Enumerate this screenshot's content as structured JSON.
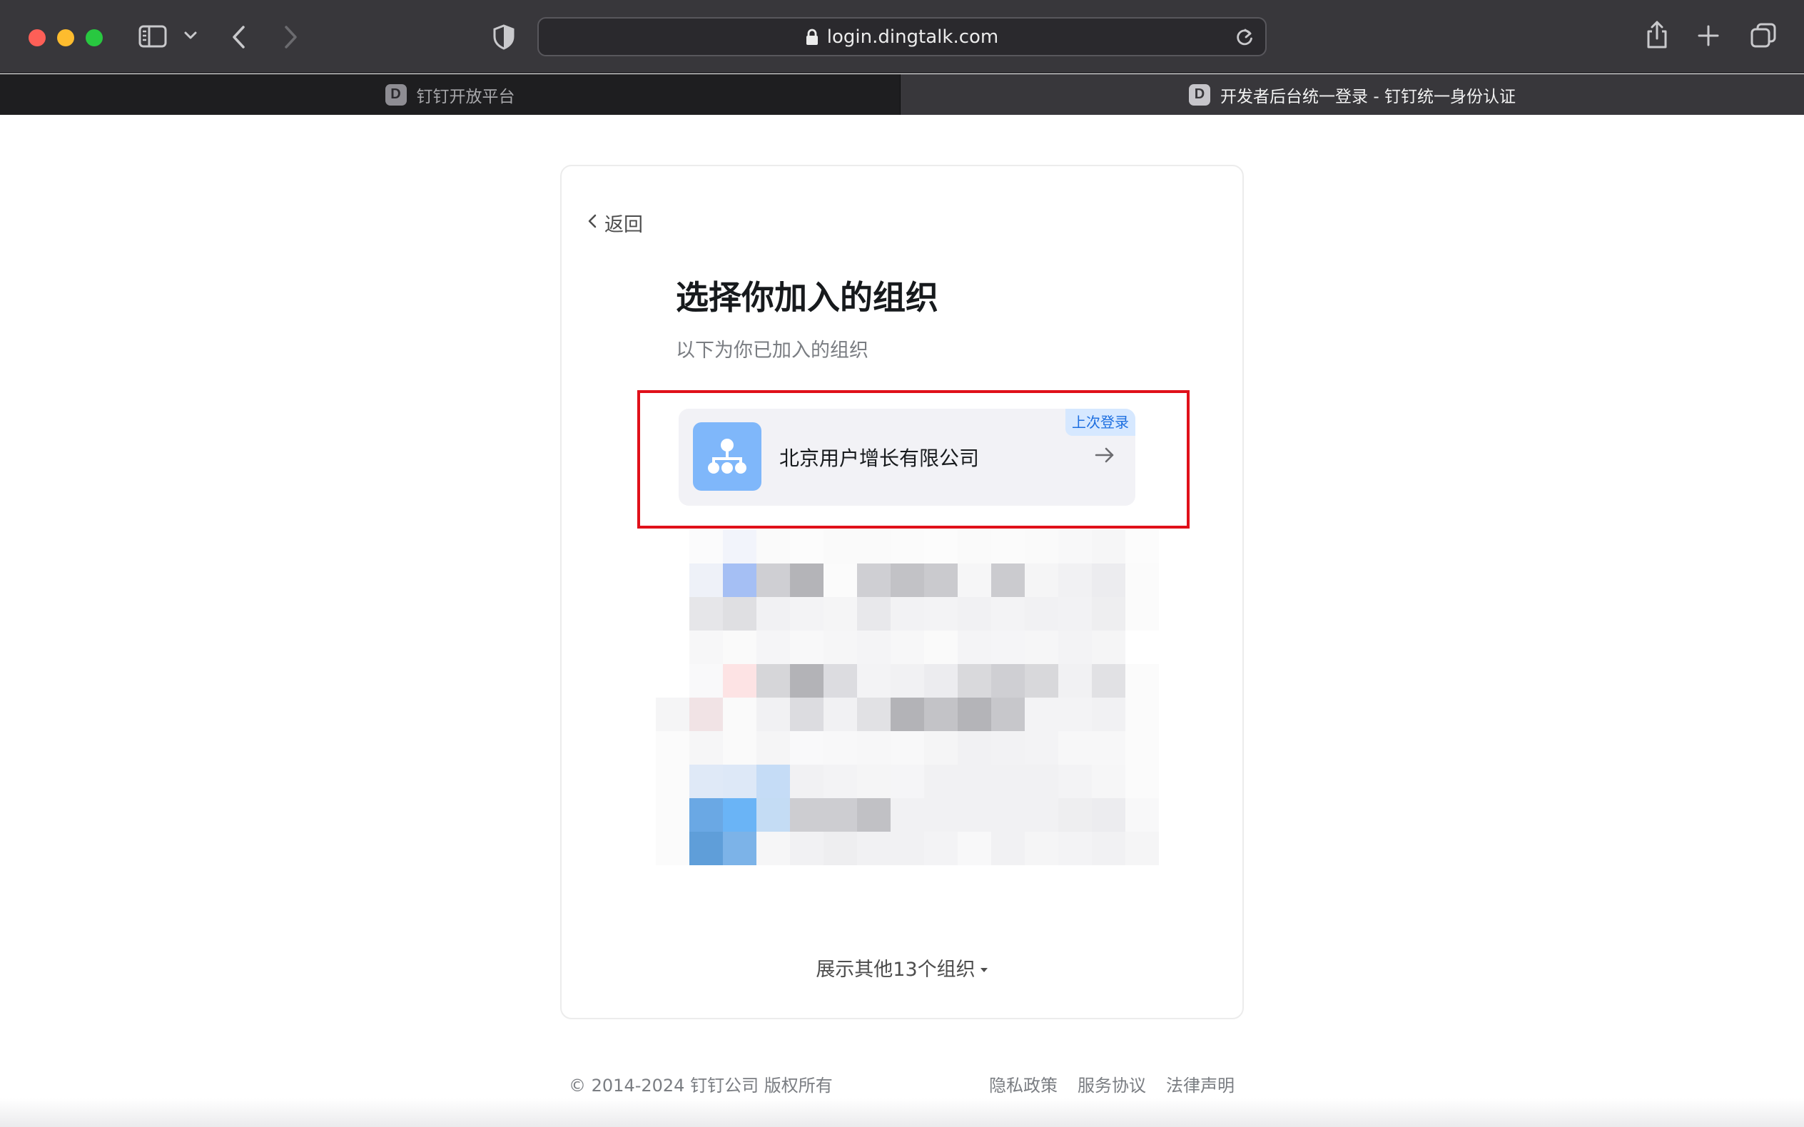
{
  "browser": {
    "url": "login.dingtalk.com",
    "tabs": [
      {
        "favicon": "D",
        "label": "钉钉开放平台",
        "active": false
      },
      {
        "favicon": "D",
        "label": "开发者后台统一登录 - 钉钉统一身份认证",
        "active": true
      }
    ],
    "icons": [
      "sidebar-icon",
      "chevron-down-icon",
      "back-icon",
      "forward-icon",
      "shield-icon",
      "lock-icon",
      "reload-icon",
      "share-icon",
      "plus-icon",
      "tabs-overview-icon"
    ]
  },
  "page": {
    "back_label": "返回",
    "title": "选择你加入的组织",
    "subtitle": "以下为你已加入的组织",
    "highlight_color": "#e0101a",
    "selected_org": {
      "name": "北京用户增长有限公司",
      "badge": "上次登录",
      "icon": "organization-icon",
      "avatar_color": "#7fb7fa"
    },
    "show_more": "展示其他13个组织"
  },
  "footer": {
    "copyright": "© 2014-2024 钉钉公司 版权所有",
    "links": [
      "隐私政策",
      "服务协议",
      "法律声明"
    ]
  },
  "colors": {
    "accent": "#1d6fe0",
    "toolbar": "#38373b"
  }
}
